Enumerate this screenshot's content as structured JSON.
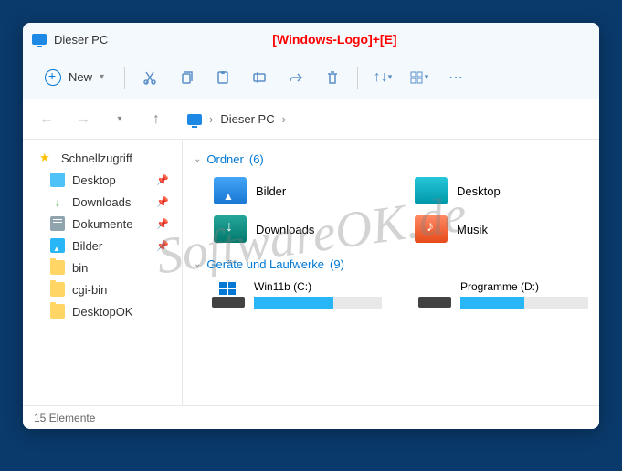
{
  "title": "Dieser PC",
  "hotkey": "[Windows-Logo]+[E]",
  "toolbar": {
    "new_label": "New"
  },
  "breadcrumb": {
    "location": "Dieser PC"
  },
  "sidebar": {
    "quickaccess_label": "Schnellzugriff",
    "items": [
      {
        "label": "Desktop",
        "pinned": true
      },
      {
        "label": "Downloads",
        "pinned": true
      },
      {
        "label": "Dokumente",
        "pinned": true
      },
      {
        "label": "Bilder",
        "pinned": true
      },
      {
        "label": "bin",
        "pinned": false
      },
      {
        "label": "cgi-bin",
        "pinned": false
      },
      {
        "label": "DesktopOK",
        "pinned": false
      }
    ]
  },
  "sections": {
    "folders": {
      "label": "Ordner",
      "count": "(6)"
    },
    "drives": {
      "label": "Geräte und Laufwerke",
      "count": "(9)"
    }
  },
  "folders": [
    {
      "label": "Bilder"
    },
    {
      "label": "Desktop"
    },
    {
      "label": "Downloads"
    },
    {
      "label": "Musik"
    }
  ],
  "drives": [
    {
      "label": "Win11b (C:)",
      "fill_pct": 62
    },
    {
      "label": "Programme (D:)",
      "fill_pct": 50
    }
  ],
  "statusbar": {
    "count": "15 Elemente"
  },
  "watermark": "SoftwareOK.de"
}
